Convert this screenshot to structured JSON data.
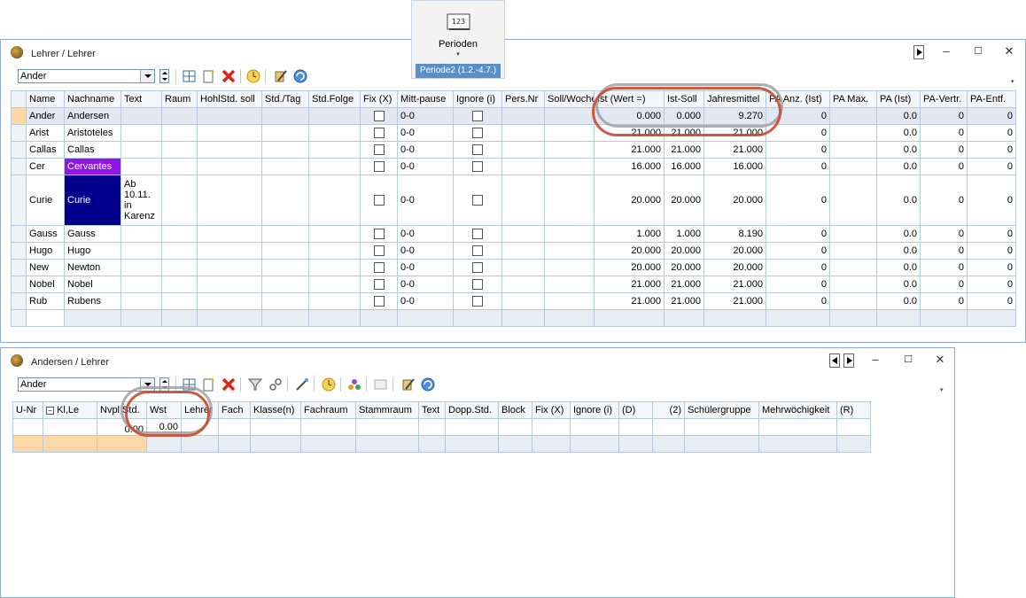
{
  "perioden": {
    "label": "Perioden",
    "icon_text": "123",
    "dropdown_arrow": "▾",
    "period": "Periode2 (1.2.-4.7.)"
  },
  "win1": {
    "title": "Lehrer / Lehrer",
    "filter_value": "Ander",
    "columns": [
      "Name",
      "Nachname",
      "Text",
      "Raum",
      "HohlStd. soll",
      "Std./Tag",
      "Std.Folge",
      "Fix (X)",
      "Mitt-pause",
      "Ignore (i)",
      "Pers.Nr",
      "Soll/Woche",
      "Ist (Wert =)",
      "Ist-Soll",
      "Jahresmittel",
      "PA Anz. (Ist)",
      "PA Max.",
      "PA (Ist)",
      "PA-Vertr.",
      "PA-Entf."
    ],
    "rows": [
      {
        "name": "Ander",
        "nachname": "Andersen",
        "text": "",
        "mitt": "0-0",
        "ist": "0.000",
        "ist_soll": "0.000",
        "jahres": "9.270",
        "pa_anz": "0",
        "pa_ist": "0.0",
        "pa_vertr": "0",
        "pa_entf": "0"
      },
      {
        "name": "Arist",
        "nachname": "Aristoteles",
        "text": "",
        "mitt": "0-0",
        "ist": "21.000",
        "ist_soll": "21.000",
        "jahres": "21.000",
        "pa_anz": "0",
        "pa_ist": "0.0",
        "pa_vertr": "0",
        "pa_entf": "0"
      },
      {
        "name": "Callas",
        "nachname": "Callas",
        "text": "",
        "mitt": "0-0",
        "ist": "21.000",
        "ist_soll": "21.000",
        "jahres": "21.000",
        "pa_anz": "0",
        "pa_ist": "0.0",
        "pa_vertr": "0",
        "pa_entf": "0"
      },
      {
        "name": "Cer",
        "nachname": "Cervantes",
        "text": "",
        "mitt": "0-0",
        "ist": "16.000",
        "ist_soll": "16.000",
        "jahres": "16.000",
        "pa_anz": "0",
        "pa_ist": "0.0",
        "pa_vertr": "0",
        "pa_entf": "0"
      },
      {
        "name": "Curie",
        "nachname": "Curie",
        "text": "Ab 10.11. in Karenz",
        "mitt": "0-0",
        "ist": "20.000",
        "ist_soll": "20.000",
        "jahres": "20.000",
        "pa_anz": "0",
        "pa_ist": "0.0",
        "pa_vertr": "0",
        "pa_entf": "0"
      },
      {
        "name": "Gauss",
        "nachname": "Gauss",
        "text": "",
        "mitt": "0-0",
        "ist": "1.000",
        "ist_soll": "1.000",
        "jahres": "8.190",
        "pa_anz": "0",
        "pa_ist": "0.0",
        "pa_vertr": "0",
        "pa_entf": "0"
      },
      {
        "name": "Hugo",
        "nachname": "Hugo",
        "text": "",
        "mitt": "0-0",
        "ist": "20.000",
        "ist_soll": "20.000",
        "jahres": "20.000",
        "pa_anz": "0",
        "pa_ist": "0.0",
        "pa_vertr": "0",
        "pa_entf": "0"
      },
      {
        "name": "New",
        "nachname": "Newton",
        "text": "",
        "mitt": "0-0",
        "ist": "20.000",
        "ist_soll": "20.000",
        "jahres": "20.000",
        "pa_anz": "0",
        "pa_ist": "0.0",
        "pa_vertr": "0",
        "pa_entf": "0"
      },
      {
        "name": "Nobel",
        "nachname": "Nobel",
        "text": "",
        "mitt": "0-0",
        "ist": "21.000",
        "ist_soll": "21.000",
        "jahres": "21.000",
        "pa_anz": "0",
        "pa_ist": "0.0",
        "pa_vertr": "0",
        "pa_entf": "0"
      },
      {
        "name": "Rub",
        "nachname": "Rubens",
        "text": "",
        "mitt": "0-0",
        "ist": "21.000",
        "ist_soll": "21.000",
        "jahres": "21.000",
        "pa_anz": "0",
        "pa_ist": "0.0",
        "pa_vertr": "0",
        "pa_entf": "0"
      }
    ]
  },
  "win2": {
    "title": "Andersen / Lehrer",
    "filter_value": "Ander",
    "columns": [
      "U-Nr",
      "Kl,Le",
      "Nvpl Std.",
      "Wst",
      "Lehrer",
      "Fach",
      "Klasse(n)",
      "Fachraum",
      "Stammraum",
      "Text",
      "Dopp.Std.",
      "Block",
      "Fix (X)",
      "Ignore (i)",
      "(D)",
      "(2)",
      "Schülergruppe",
      "Mehrwöchigkeit",
      "(R)"
    ],
    "klle_toggle": "−",
    "row1": {
      "nvpl": "0.00",
      "wst": "0.00"
    }
  },
  "window_controls": {
    "minimize": "–",
    "maximize": "☐",
    "close": "✕"
  },
  "colors": {
    "accent_red": "#c6492e",
    "selection": "#fbd9a4",
    "cervantes": "#9016e8",
    "curie": "#00008c",
    "period_bar": "#5a8ec6"
  }
}
